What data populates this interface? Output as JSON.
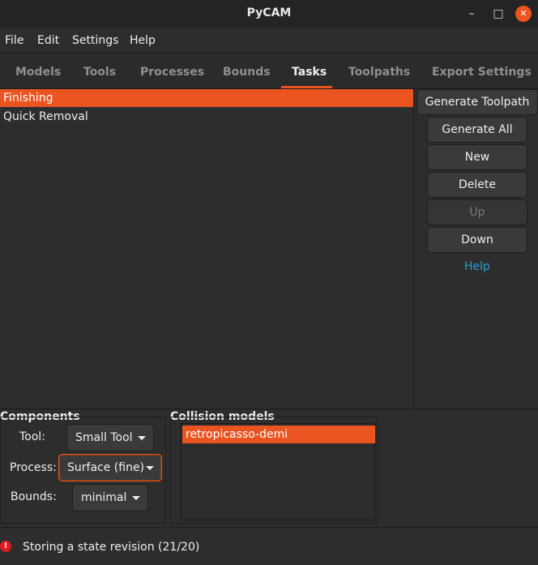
{
  "window": {
    "title": "PyCAM"
  },
  "menubar": {
    "items": [
      "File",
      "Edit",
      "Settings",
      "Help"
    ]
  },
  "tabs": [
    "Models",
    "Tools",
    "Processes",
    "Bounds",
    "Tasks",
    "Toolpaths",
    "Export Settings"
  ],
  "active_tab": "Tasks",
  "tasks": [
    "Finishing",
    "Quick Removal"
  ],
  "selected_task": "Finishing",
  "side_buttons": {
    "generate_toolpath": "Generate Toolpath",
    "generate_all": "Generate All",
    "new": "New",
    "delete": "Delete",
    "up": "Up",
    "down": "Down",
    "help": "Help"
  },
  "components": {
    "title": "Components",
    "tool_label": "Tool:",
    "tool_value": "Small Tool",
    "process_label": "Process:",
    "process_value": "Surface (fine)",
    "bounds_label": "Bounds:",
    "bounds_value": "minimal"
  },
  "collision": {
    "title": "Collision models",
    "items": [
      "retropicasso-demi"
    ]
  },
  "status": {
    "icon": "error-icon",
    "text": "Storing a state revision (21/20)"
  },
  "colors": {
    "accent": "#e95420",
    "link": "#2c9fd6",
    "error": "#e01b24",
    "background": "#2d2d2d"
  }
}
